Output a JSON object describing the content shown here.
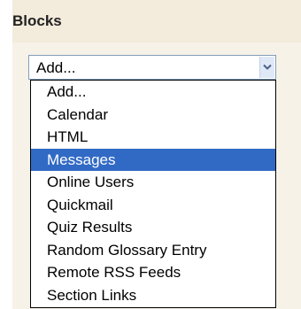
{
  "blocks": {
    "title": "Blocks",
    "select": {
      "value": "Add..."
    },
    "dropdown": {
      "selected_index": 3,
      "highlight_color": "#316ac5",
      "options": [
        {
          "label": "Add..."
        },
        {
          "label": "Calendar"
        },
        {
          "label": "HTML"
        },
        {
          "label": "Messages"
        },
        {
          "label": "Online Users"
        },
        {
          "label": "Quickmail"
        },
        {
          "label": "Quiz Results"
        },
        {
          "label": "Random Glossary Entry"
        },
        {
          "label": "Remote RSS Feeds"
        },
        {
          "label": "Section Links"
        }
      ]
    }
  },
  "icons": {
    "select_arrow": "chevron-down-icon"
  }
}
